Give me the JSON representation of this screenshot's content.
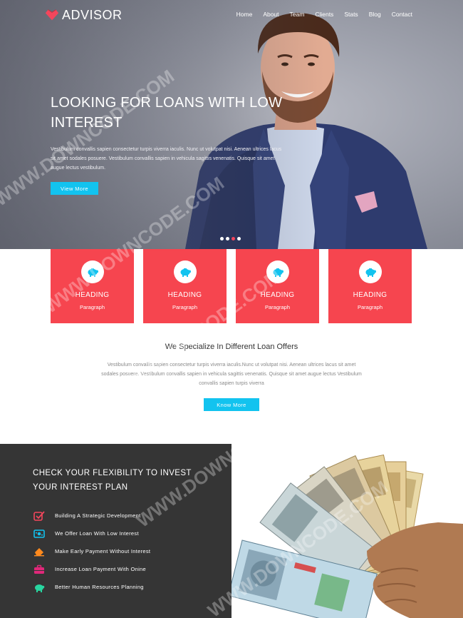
{
  "brand": {
    "name": "ADVISOR",
    "icon": "logo-icon",
    "color": "#f3465c"
  },
  "nav": [
    "Home",
    "About",
    "Team",
    "Clients",
    "Stats",
    "Blog",
    "Contact"
  ],
  "hero": {
    "title": "LOOKING FOR LOANS WITH LOW INTEREST",
    "text": "Vestibulum convallis sapien consectetur turpis viverra iaculis. Nunc ut volutpat nisi. Aenean ultrices lacus sit amet sodales posuere. Vestibulum convallis sapien in vehicula sagittis venenatis. Quisque sit amet augue lectus vestibulum.",
    "button": "View More",
    "slides": 4,
    "active_slide": 2
  },
  "cards": [
    {
      "heading": "HEADING",
      "paragraph": "Paragraph",
      "icon": "piggy-bank-icon"
    },
    {
      "heading": "HEADING",
      "paragraph": "Paragraph",
      "icon": "piggy-bank-icon"
    },
    {
      "heading": "HEADING",
      "paragraph": "Paragraph",
      "icon": "piggy-bank-icon"
    },
    {
      "heading": "HEADING",
      "paragraph": "Paragraph",
      "icon": "piggy-bank-icon"
    }
  ],
  "specialize": {
    "title": "We Specialize In Different Loan Offers",
    "text": "Vestibulum convallis sapien consectetur turpis viverra iaculis.Nunc ut volutpat nisi. Aenean ultrices lacus sit amet sodales posuere. Vestibulum convallis sapien in vehicula sagittis venenatis. Quisque sit amet augue lectus Vestibulum convallis sapien turpis viverra",
    "button": "Know More"
  },
  "flexibility": {
    "title": "CHECK YOUR FLEXIBILITY TO INVEST YOUR INTEREST PLAN",
    "items": [
      {
        "label": "Building A Strategic Development",
        "icon": "checkbox-icon",
        "color": "#f3465c"
      },
      {
        "label": "We Offer Loan With Low Interest",
        "icon": "money-icon",
        "color": "#12c3ef"
      },
      {
        "label": "Make Early Payment Without Interest",
        "icon": "eraser-icon",
        "color": "#ff8a1e"
      },
      {
        "label": "Increase Loan Payment With Onine",
        "icon": "briefcase-icon",
        "color": "#e0287a"
      },
      {
        "label": "Better Human Resources Planning",
        "icon": "piggy-bank-icon",
        "color": "#28d6a0"
      }
    ]
  },
  "colors": {
    "accent_red": "#f6454f",
    "accent_cyan": "#12c3ef",
    "dark_panel": "#353535"
  },
  "watermark": "WWW.DOWNCODE.COM"
}
